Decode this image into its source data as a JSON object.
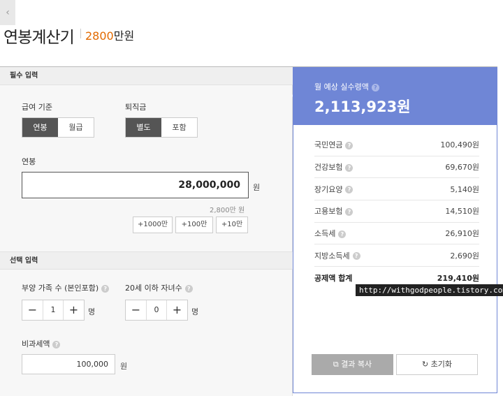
{
  "header": {
    "back_glyph": "‹",
    "title": "연봉계산기",
    "summary_amount": "2800",
    "summary_unit": "만원"
  },
  "required": {
    "section_title": "필수 입력",
    "pay_basis": {
      "label": "급여 기준",
      "options": [
        "연봉",
        "월급"
      ],
      "selected": "연봉"
    },
    "severance": {
      "label": "퇴직금",
      "options": [
        "별도",
        "포함"
      ],
      "selected": "별도"
    },
    "salary": {
      "label": "연봉",
      "value": "28,000,000",
      "unit": "원",
      "hint": "2,800만 원"
    },
    "quick_add": [
      "+1000만",
      "+100만",
      "+10만"
    ]
  },
  "optional": {
    "section_title": "선택 입력",
    "dependents": {
      "label": "부양 가족 수 (본인포함)",
      "value": "1",
      "unit": "명",
      "minus": "−",
      "plus": "+"
    },
    "children": {
      "label": "20세 이하 자녀수",
      "value": "0",
      "unit": "명",
      "minus": "−",
      "plus": "+"
    },
    "nontax": {
      "label": "비과세액",
      "value": "100,000",
      "unit": "원"
    }
  },
  "result": {
    "label": "월 예상 실수령액",
    "amount": "2,113,923원",
    "help_glyph": "?",
    "rows": [
      {
        "name": "국민연금",
        "value": "100,490원"
      },
      {
        "name": "건강보험",
        "value": "69,670원"
      },
      {
        "name": "장기요양",
        "value": "5,140원"
      },
      {
        "name": "고용보험",
        "value": "14,510원"
      },
      {
        "name": "소득세",
        "value": "26,910원"
      },
      {
        "name": "지방소득세",
        "value": "2,690원"
      },
      {
        "name": "공제액 합계",
        "value": "219,410원"
      }
    ],
    "copy_button": "결과 복사",
    "copy_icon": "⧉",
    "reset_button": "초기화",
    "reset_icon": "↻"
  },
  "watermark": "http://withgodpeople.tistory.com",
  "colors": {
    "accent": "#6f86d6",
    "title_amount": "#e26a00",
    "toggle_on": "#555555"
  }
}
